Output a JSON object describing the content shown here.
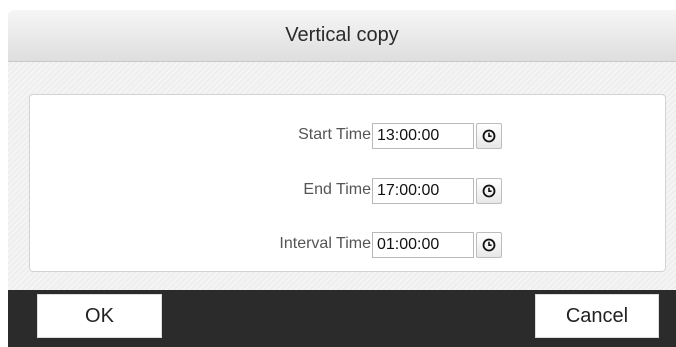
{
  "dialog": {
    "title": "Vertical copy"
  },
  "fields": [
    {
      "label": "Start Time",
      "value": "13:00:00",
      "icon": "clock-icon"
    },
    {
      "label": "End Time",
      "value": "17:00:00",
      "icon": "clock-icon"
    },
    {
      "label": "Interval Time",
      "value": "01:00:00",
      "icon": "clock-icon"
    }
  ],
  "buttons": {
    "ok_label": "OK",
    "cancel_label": "Cancel"
  },
  "colors": {
    "footer_bg": "#2b2b2b",
    "title_bar": "#e6e6e6",
    "panel_bg": "#ffffff"
  }
}
